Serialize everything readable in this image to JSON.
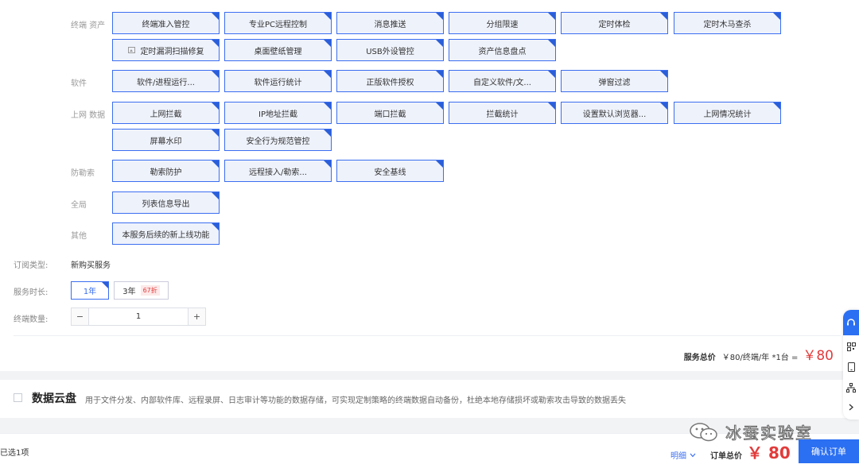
{
  "categories": [
    {
      "label": "终端 资产",
      "chips": [
        "终端准入管控",
        "专业PC远程控制",
        "消息推送",
        "分组限速",
        "定时体检",
        "定时木马查杀",
        "定时漏洞扫描修复",
        "桌面壁纸管理",
        "USB外设管控",
        "资产信息盘点"
      ]
    },
    {
      "label": "软件",
      "chips": [
        "软件/进程运行...",
        "软件运行统计",
        "正版软件授权",
        "自定义软件/文...",
        "弹窗过滤"
      ]
    },
    {
      "label": "上网 数据",
      "chips": [
        "上网拦截",
        "IP地址拦截",
        "端口拦截",
        "拦截统计",
        "设置默认浏览器...",
        "上网情况统计",
        "屏幕水印",
        "安全行为规范管控"
      ]
    },
    {
      "label": "防勒索",
      "chips": [
        "勒索防护",
        "远程接入/勒索...",
        "安全基线"
      ]
    },
    {
      "label": "全局",
      "chips": [
        "列表信息导出"
      ]
    },
    {
      "label": "其他",
      "chips": [
        "本服务后续的新上线功能"
      ]
    }
  ],
  "subscription": {
    "label": "订阅类型:",
    "value": "新购买服务"
  },
  "duration": {
    "label": "服务时长:",
    "options": [
      {
        "text": "1年"
      },
      {
        "text": "3年",
        "badge": "67折"
      }
    ]
  },
  "quantity": {
    "label": "终端数量:",
    "minus": "−",
    "value": "1",
    "plus": "+"
  },
  "service_total": {
    "label": "服务总价",
    "calc": "￥80/终端/年 *1台 =",
    "price": "￥80"
  },
  "cloud": {
    "title": "数据云盘",
    "desc": "用于文件分发、内部软件库、远程录屏、日志审计等功能的数据存储，可实现定制策略的终端数据自动备份，杜绝本地存储损坏或勒索攻击导致的数据丢失"
  },
  "footer": {
    "selected": "已选1项",
    "detail": "明细",
    "order_label": "订单总价",
    "order_price": "￥ 80",
    "confirm": "确认订单",
    "watermark": "冰蚕实验室"
  },
  "sidebar_icons": [
    "headset-icon",
    "qr-code-icon",
    "mobile-icon",
    "sitemap-icon",
    "chevron-right-icon"
  ],
  "colors": {
    "accent": "#2b6ff2",
    "price": "#e23b3b"
  }
}
